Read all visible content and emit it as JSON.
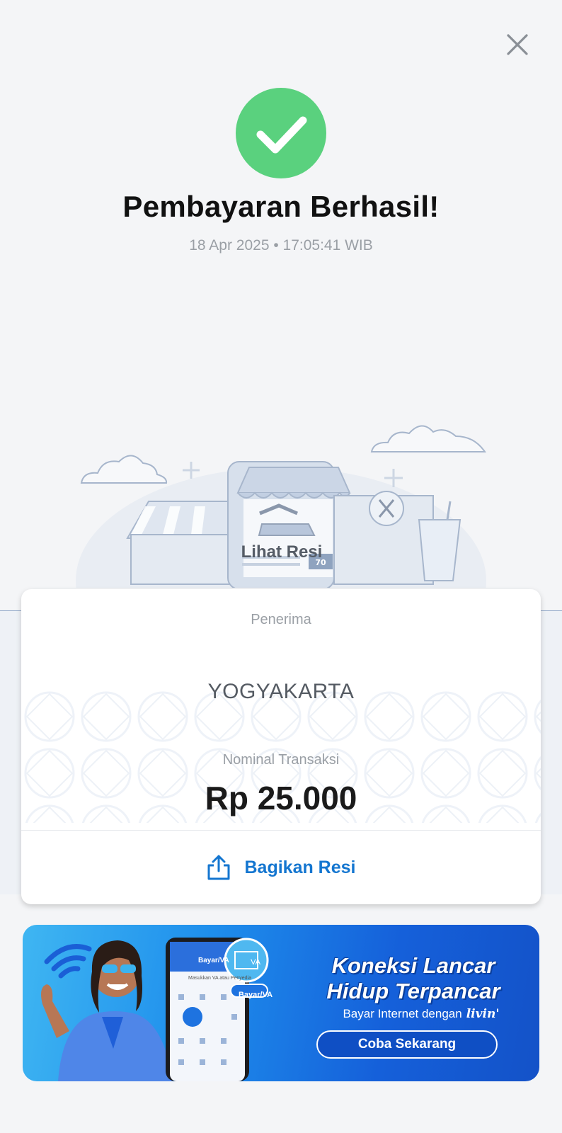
{
  "header": {
    "close_icon": "close-icon",
    "status_icon": "check-circle-icon",
    "status_color": "#5ad17e",
    "title": "Pembayaran Berhasil!",
    "datetime": "18 Apr 2025 • 17:05:41 WIB"
  },
  "illustration": {
    "name": "shop-illustration",
    "lihat_resi": "Lihat Resi",
    "discount_badge": "70"
  },
  "receipt": {
    "recipient_label": "Penerima",
    "recipient_value": "YOGYAKARTA",
    "amount_label": "Nominal Transaksi",
    "amount_value": "Rp 25.000",
    "share_label": "Bagikan Resi",
    "share_icon": "share-icon",
    "accent_color": "#1476d0"
  },
  "banner": {
    "headline_1": "Koneksi Lancar",
    "headline_2": "Hidup Terpancar",
    "subtitle": "Bayar Internet dengan",
    "brand": "livin'",
    "cta": "Coba Sekarang",
    "phone_header": "Bayar/VA",
    "phone_search": "Masukkan VA atau Penyedia",
    "va_badge": "VA",
    "va_label": "Bayar/VA",
    "wifi_icon": "wifi-icon"
  }
}
